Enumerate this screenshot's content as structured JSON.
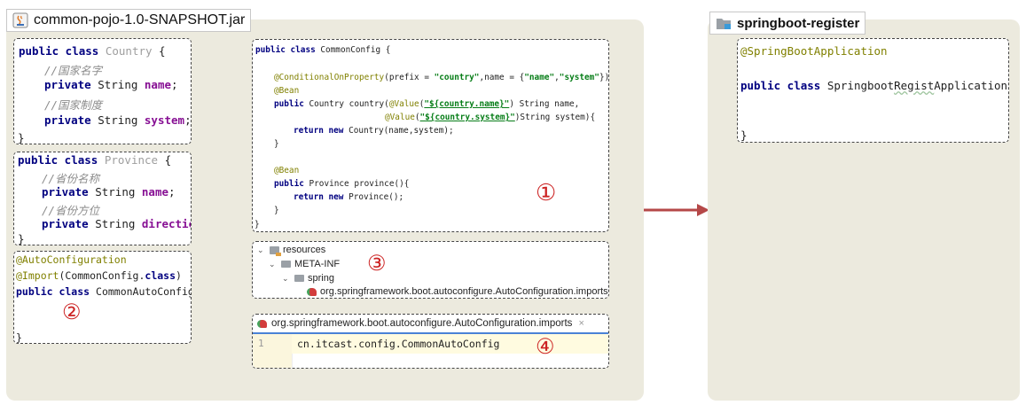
{
  "left_jar": {
    "tab_title": "common-pojo-1.0-SNAPSHOT.jar",
    "icon": "jar-file-icon",
    "country_class": {
      "l1_kw": "public class ",
      "l1_name": "Country",
      "l1_end": " {",
      "l2_comment": "//国家名字",
      "l3_kw": "private ",
      "l3_type": "String ",
      "l3_field": "name",
      "l3_end": ";",
      "l4_comment": "//国家制度",
      "l5_kw": "private ",
      "l5_type": "String ",
      "l5_field": "system",
      "l5_end": ";",
      "l6_close": "}"
    },
    "province_class": {
      "l1_kw": "public class ",
      "l1_name": "Province",
      "l1_end": " {",
      "l2_comment": "//省份名称",
      "l3_kw": "private ",
      "l3_type": "String ",
      "l3_field": "name",
      "l3_end": ";",
      "l4_comment": "//省份方位",
      "l5_kw": "private ",
      "l5_type": "String ",
      "l5_field": "direction",
      "l5_end": ";",
      "l6_close": "}"
    },
    "auto_config_class": {
      "l1_ann": "@AutoConfiguration",
      "l2_ann": "@Import",
      "l2_rest1": "(CommonConfig.",
      "l2_kw": "class",
      "l2_rest2": ")",
      "l3_kw": "public class ",
      "l3_name": "CommonAutoConfig {",
      "l5_close": "}",
      "marker": "②"
    },
    "common_config_class": {
      "l1_kw": "public class ",
      "l1_name": "CommonConfig {",
      "l3_ann": "@ConditionalOnProperty",
      "l3_a": "(prefix = ",
      "l3_s1": "\"country\"",
      "l3_b": ",name = {",
      "l3_s2": "\"name\"",
      "l3_c": ",",
      "l3_s3": "\"system\"",
      "l3_d": "})",
      "l4_ann": "@Bean",
      "l5_kw": "public ",
      "l5_a": "Country country(",
      "l5_ann": "@Value",
      "l5_b": "(",
      "l5_s": "\"${country.name}\"",
      "l5_c": ") String name,",
      "l6_ann": "@Value",
      "l6_b": "(",
      "l6_s": "\"${country.system}\"",
      "l6_c": ")String system){",
      "l7_kw": "return new ",
      "l7_a": "Country(name,system);",
      "l8_close": "}",
      "l10_ann": "@Bean",
      "l11_kw": "public ",
      "l11_a": "Province province(){",
      "l12_kw": "return new ",
      "l12_a": "Province();",
      "l13_close": "}",
      "l14_close": "}",
      "marker": "①"
    },
    "resources_tree": {
      "root": "resources",
      "meta_inf": "META-INF",
      "spring": "spring",
      "imports_file": "org.springframework.boot.autoconfigure.AutoConfiguration.imports",
      "marker": "③"
    },
    "imports_editor": {
      "tab_label": "org.springframework.boot.autoconfigure.AutoConfiguration.imports",
      "close_glyph": "×",
      "line_number": "1",
      "line_content": "cn.itcast.config.CommonAutoConfig",
      "marker": "④"
    }
  },
  "right_project": {
    "tab_title": "springboot-register",
    "icon": "module-folder-icon",
    "l1_ann": "@SpringBootApplication",
    "l3_kw": "public class ",
    "l3_a": "Springboot",
    "l3_u": "Regist",
    "l3_b": "Application {",
    "l5_close": "}"
  },
  "colors": {
    "panel_bg": "#eceade",
    "arrow": "#b54848",
    "marker": "#cc2222"
  }
}
